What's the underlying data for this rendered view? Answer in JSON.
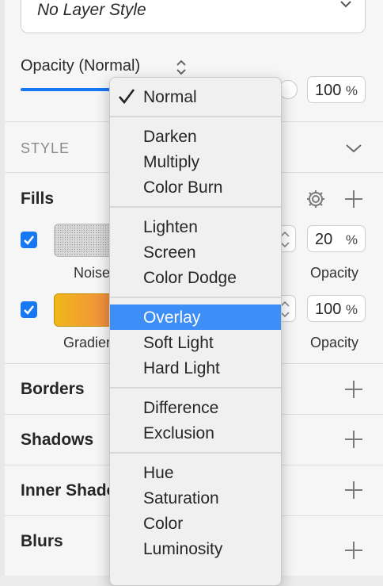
{
  "layer_style": {
    "value": "No Layer Style"
  },
  "opacity": {
    "label": "Opacity (Normal)",
    "value": "100",
    "unit": "%",
    "slider_fraction": 0.95
  },
  "style_header": "STYLE",
  "fills": {
    "title": "Fills",
    "items": [
      {
        "swatch_label": "Noise",
        "opacity_value": "20",
        "opacity_unit": "%",
        "opacity_label": "Opacity",
        "enabled": true
      },
      {
        "swatch_label": "Gradient",
        "opacity_value": "100",
        "opacity_unit": "%",
        "opacity_label": "Opacity",
        "enabled": true
      }
    ]
  },
  "sections": {
    "borders": "Borders",
    "shadows": "Shadows",
    "inner_shadows": "Inner Shadows",
    "blurs": "Blurs"
  },
  "blend_menu": {
    "checked": "Normal",
    "highlighted": "Overlay",
    "groups": [
      [
        "Normal"
      ],
      [
        "Darken",
        "Multiply",
        "Color Burn"
      ],
      [
        "Lighten",
        "Screen",
        "Color Dodge"
      ],
      [
        "Overlay",
        "Soft Light",
        "Hard Light"
      ],
      [
        "Difference",
        "Exclusion"
      ],
      [
        "Hue",
        "Saturation",
        "Color",
        "Luminosity"
      ]
    ]
  },
  "colors": {
    "accent": "#1877f2",
    "highlight": "#3d8ef6"
  },
  "icons": {
    "checkmark": "checkmark-icon",
    "gear": "gear-icon",
    "plus": "plus-icon",
    "chevron": "chevron-down-icon"
  }
}
